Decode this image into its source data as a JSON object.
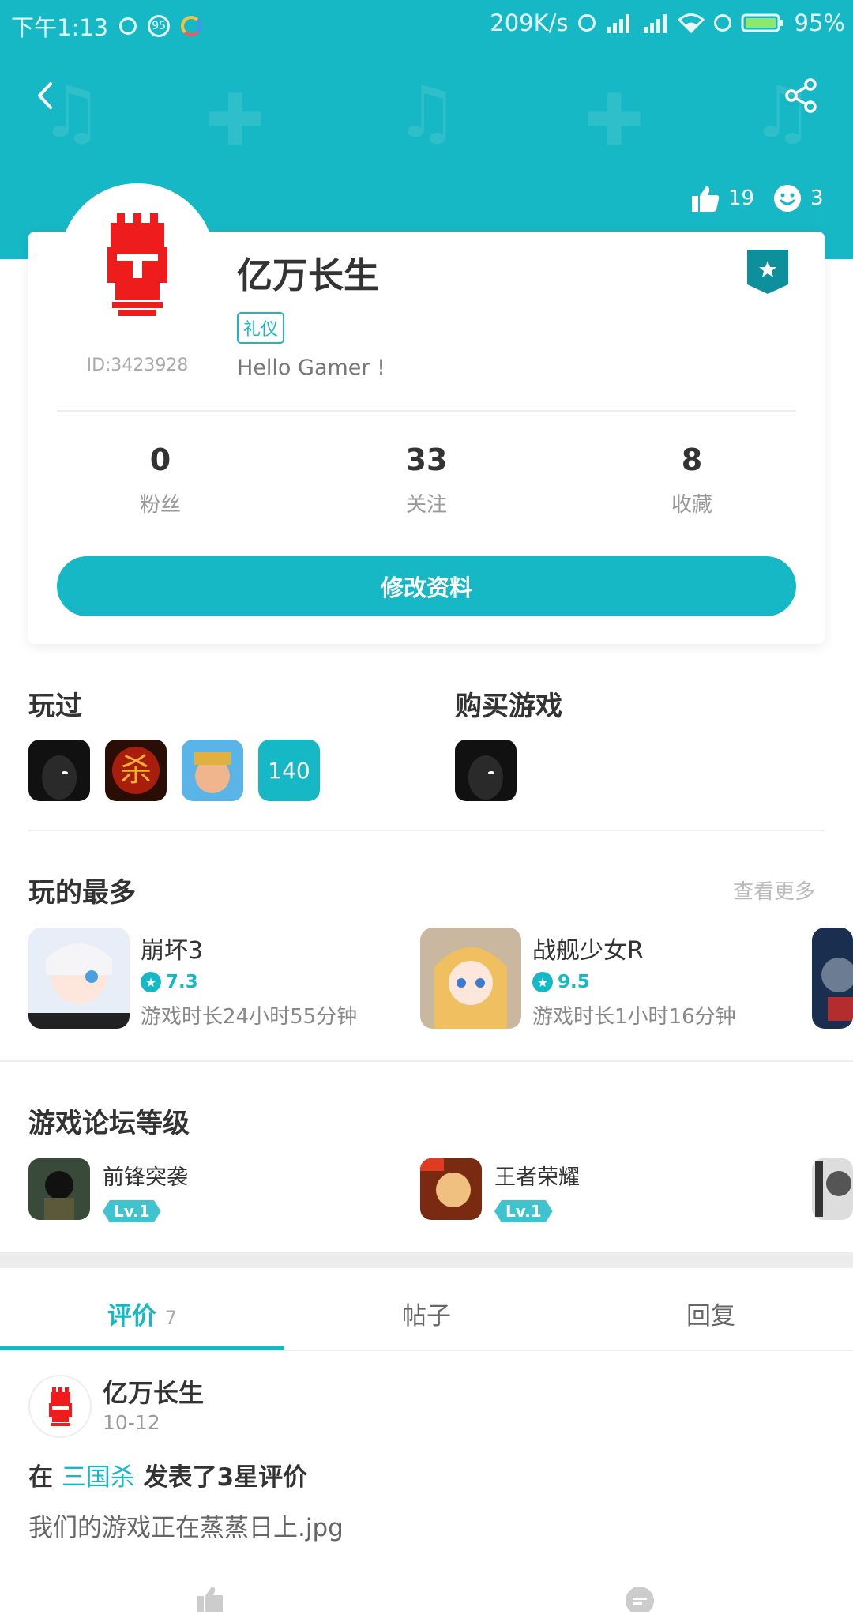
{
  "status_bar": {
    "time": "下午1:13",
    "battery_saver": "95",
    "net_speed": "209K/s",
    "battery": "95%"
  },
  "header": {
    "likes": "19",
    "smiles": "3"
  },
  "profile": {
    "name": "亿万长生",
    "id_label": "ID:3423928",
    "role_tag": "礼仪",
    "bio": "Hello Gamer !",
    "stats": [
      {
        "value": "0",
        "label": "粉丝"
      },
      {
        "value": "33",
        "label": "关注"
      },
      {
        "value": "8",
        "label": "收藏"
      }
    ],
    "edit_button": "修改资料"
  },
  "played": {
    "title": "玩过",
    "count": "140"
  },
  "purchased": {
    "title": "购买游戏"
  },
  "most_played": {
    "title": "玩的最多",
    "more": "查看更多",
    "items": [
      {
        "name": "崩坏3",
        "rating": "7.3",
        "time": "游戏时长24小时55分钟"
      },
      {
        "name": "战舰少女R",
        "rating": "9.5",
        "time": "游戏时长1小时16分钟"
      }
    ]
  },
  "forum_levels": {
    "title": "游戏论坛等级",
    "items": [
      {
        "name": "前锋突袭",
        "level": "Lv.1"
      },
      {
        "name": "王者荣耀",
        "level": "Lv.1"
      }
    ]
  },
  "tabs": [
    {
      "label": "评价",
      "count": "7"
    },
    {
      "label": "帖子"
    },
    {
      "label": "回复"
    }
  ],
  "post": {
    "author": "亿万长生",
    "date": "10-12",
    "title_prefix": "在",
    "game": "三国杀",
    "title_suffix": "发表了3星评价",
    "body": "我们的游戏正在蒸蒸日上.jpg"
  },
  "colors": {
    "accent": "#17b8c6",
    "avatar_red": "#ee1c1c"
  }
}
